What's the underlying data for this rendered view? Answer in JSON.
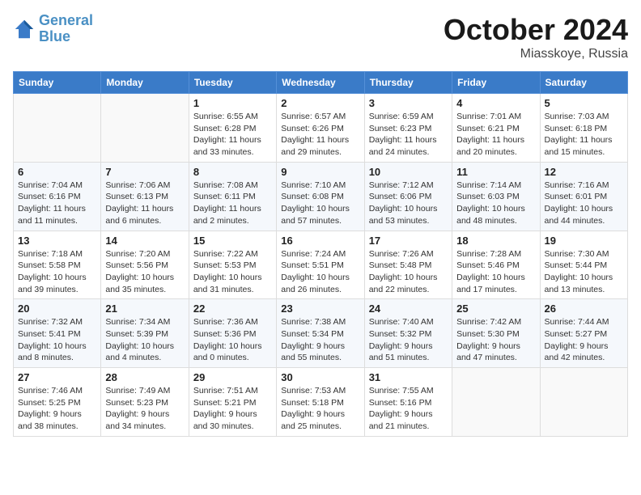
{
  "header": {
    "logo_line1": "General",
    "logo_line2": "Blue",
    "month": "October 2024",
    "location": "Miasskoye, Russia"
  },
  "weekdays": [
    "Sunday",
    "Monday",
    "Tuesday",
    "Wednesday",
    "Thursday",
    "Friday",
    "Saturday"
  ],
  "weeks": [
    [
      {
        "day": "",
        "info": ""
      },
      {
        "day": "",
        "info": ""
      },
      {
        "day": "1",
        "info": "Sunrise: 6:55 AM\nSunset: 6:28 PM\nDaylight: 11 hours\nand 33 minutes."
      },
      {
        "day": "2",
        "info": "Sunrise: 6:57 AM\nSunset: 6:26 PM\nDaylight: 11 hours\nand 29 minutes."
      },
      {
        "day": "3",
        "info": "Sunrise: 6:59 AM\nSunset: 6:23 PM\nDaylight: 11 hours\nand 24 minutes."
      },
      {
        "day": "4",
        "info": "Sunrise: 7:01 AM\nSunset: 6:21 PM\nDaylight: 11 hours\nand 20 minutes."
      },
      {
        "day": "5",
        "info": "Sunrise: 7:03 AM\nSunset: 6:18 PM\nDaylight: 11 hours\nand 15 minutes."
      }
    ],
    [
      {
        "day": "6",
        "info": "Sunrise: 7:04 AM\nSunset: 6:16 PM\nDaylight: 11 hours\nand 11 minutes."
      },
      {
        "day": "7",
        "info": "Sunrise: 7:06 AM\nSunset: 6:13 PM\nDaylight: 11 hours\nand 6 minutes."
      },
      {
        "day": "8",
        "info": "Sunrise: 7:08 AM\nSunset: 6:11 PM\nDaylight: 11 hours\nand 2 minutes."
      },
      {
        "day": "9",
        "info": "Sunrise: 7:10 AM\nSunset: 6:08 PM\nDaylight: 10 hours\nand 57 minutes."
      },
      {
        "day": "10",
        "info": "Sunrise: 7:12 AM\nSunset: 6:06 PM\nDaylight: 10 hours\nand 53 minutes."
      },
      {
        "day": "11",
        "info": "Sunrise: 7:14 AM\nSunset: 6:03 PM\nDaylight: 10 hours\nand 48 minutes."
      },
      {
        "day": "12",
        "info": "Sunrise: 7:16 AM\nSunset: 6:01 PM\nDaylight: 10 hours\nand 44 minutes."
      }
    ],
    [
      {
        "day": "13",
        "info": "Sunrise: 7:18 AM\nSunset: 5:58 PM\nDaylight: 10 hours\nand 39 minutes."
      },
      {
        "day": "14",
        "info": "Sunrise: 7:20 AM\nSunset: 5:56 PM\nDaylight: 10 hours\nand 35 minutes."
      },
      {
        "day": "15",
        "info": "Sunrise: 7:22 AM\nSunset: 5:53 PM\nDaylight: 10 hours\nand 31 minutes."
      },
      {
        "day": "16",
        "info": "Sunrise: 7:24 AM\nSunset: 5:51 PM\nDaylight: 10 hours\nand 26 minutes."
      },
      {
        "day": "17",
        "info": "Sunrise: 7:26 AM\nSunset: 5:48 PM\nDaylight: 10 hours\nand 22 minutes."
      },
      {
        "day": "18",
        "info": "Sunrise: 7:28 AM\nSunset: 5:46 PM\nDaylight: 10 hours\nand 17 minutes."
      },
      {
        "day": "19",
        "info": "Sunrise: 7:30 AM\nSunset: 5:44 PM\nDaylight: 10 hours\nand 13 minutes."
      }
    ],
    [
      {
        "day": "20",
        "info": "Sunrise: 7:32 AM\nSunset: 5:41 PM\nDaylight: 10 hours\nand 8 minutes."
      },
      {
        "day": "21",
        "info": "Sunrise: 7:34 AM\nSunset: 5:39 PM\nDaylight: 10 hours\nand 4 minutes."
      },
      {
        "day": "22",
        "info": "Sunrise: 7:36 AM\nSunset: 5:36 PM\nDaylight: 10 hours\nand 0 minutes."
      },
      {
        "day": "23",
        "info": "Sunrise: 7:38 AM\nSunset: 5:34 PM\nDaylight: 9 hours\nand 55 minutes."
      },
      {
        "day": "24",
        "info": "Sunrise: 7:40 AM\nSunset: 5:32 PM\nDaylight: 9 hours\nand 51 minutes."
      },
      {
        "day": "25",
        "info": "Sunrise: 7:42 AM\nSunset: 5:30 PM\nDaylight: 9 hours\nand 47 minutes."
      },
      {
        "day": "26",
        "info": "Sunrise: 7:44 AM\nSunset: 5:27 PM\nDaylight: 9 hours\nand 42 minutes."
      }
    ],
    [
      {
        "day": "27",
        "info": "Sunrise: 7:46 AM\nSunset: 5:25 PM\nDaylight: 9 hours\nand 38 minutes."
      },
      {
        "day": "28",
        "info": "Sunrise: 7:49 AM\nSunset: 5:23 PM\nDaylight: 9 hours\nand 34 minutes."
      },
      {
        "day": "29",
        "info": "Sunrise: 7:51 AM\nSunset: 5:21 PM\nDaylight: 9 hours\nand 30 minutes."
      },
      {
        "day": "30",
        "info": "Sunrise: 7:53 AM\nSunset: 5:18 PM\nDaylight: 9 hours\nand 25 minutes."
      },
      {
        "day": "31",
        "info": "Sunrise: 7:55 AM\nSunset: 5:16 PM\nDaylight: 9 hours\nand 21 minutes."
      },
      {
        "day": "",
        "info": ""
      },
      {
        "day": "",
        "info": ""
      }
    ]
  ]
}
